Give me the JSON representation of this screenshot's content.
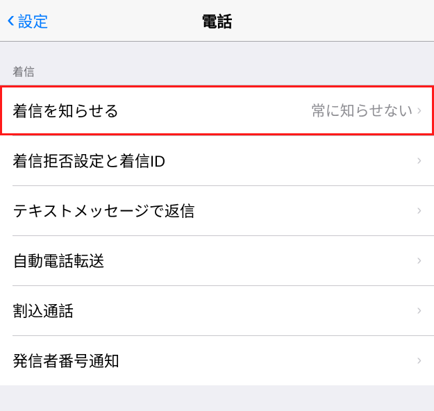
{
  "navbar": {
    "back_label": "設定",
    "title": "電話"
  },
  "section": {
    "header": "着信"
  },
  "rows": {
    "announce": {
      "label": "着信を知らせる",
      "value": "常に知らせない"
    },
    "block": {
      "label": "着信拒否設定と着信ID"
    },
    "text": {
      "label": "テキストメッセージで返信"
    },
    "forward": {
      "label": "自動電話転送"
    },
    "waiting": {
      "label": "割込通話"
    },
    "callerid": {
      "label": "発信者番号通知"
    }
  }
}
